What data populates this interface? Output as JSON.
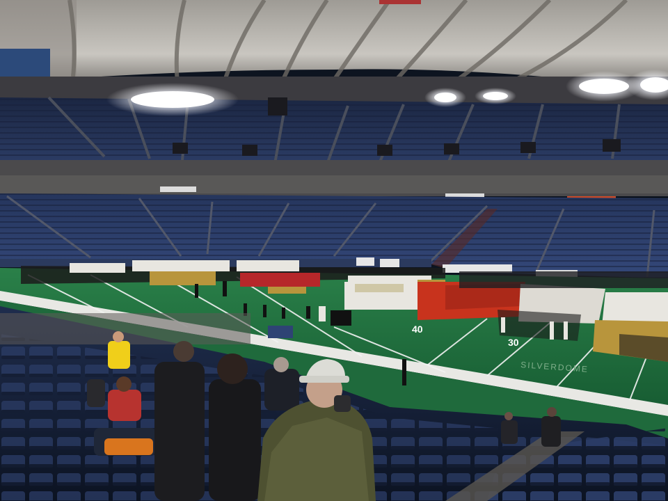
{
  "scene": {
    "description_labels": [],
    "field": {
      "yard_numbers": [
        "40",
        "30"
      ],
      "logo_text": "SILVERDOME"
    },
    "colors": {
      "roof": "#c9c6c0",
      "seats": "#2a3b63",
      "turf": "#1f6a3c",
      "lines": "#f2f2f2",
      "band_red": "#c8331d",
      "band_white": "#e8e6e0",
      "band_gold": "#b8953c"
    }
  }
}
